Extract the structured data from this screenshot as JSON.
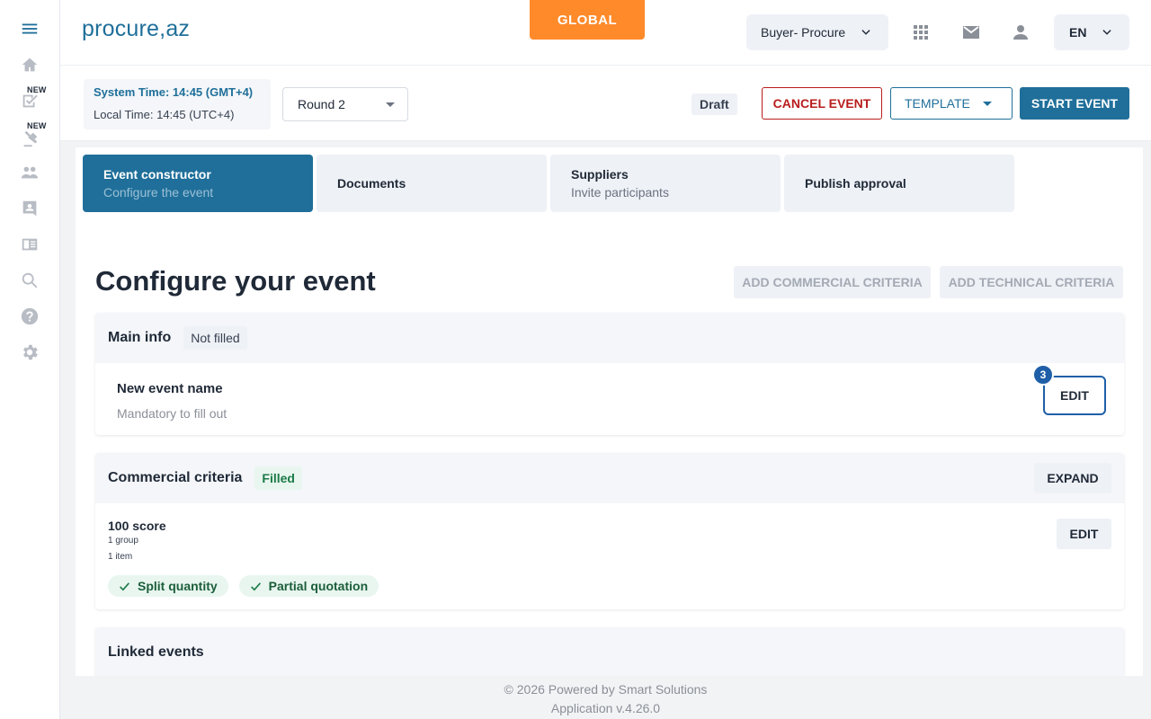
{
  "app": {
    "logo": {
      "part1": "procure",
      "comma": ",",
      "part2": "az"
    },
    "global_label": "GLOBAL",
    "buyer_select": "Buyer- Procure",
    "language": "EN"
  },
  "sidebar": {
    "new_badge_1": "NEW",
    "new_badge_2": "NEW"
  },
  "toolbar": {
    "system_time": "System Time: 14:45 (GMT+4)",
    "local_time": "Local Time: 14:45 (UTC+4)",
    "round": "Round 2",
    "status": "Draft",
    "cancel_label": "CANCEL EVENT",
    "template_label": "TEMPLATE",
    "start_label": "START EVENT"
  },
  "steps": [
    {
      "title": "Event constructor",
      "subtitle": "Configure the event"
    },
    {
      "title": "Documents",
      "subtitle": ""
    },
    {
      "title": "Suppliers",
      "subtitle": "Invite participants"
    },
    {
      "title": "Publish approval",
      "subtitle": ""
    }
  ],
  "main": {
    "title": "Configure your event",
    "add_commercial": "ADD COMMERCIAL CRITERIA",
    "add_technical": "ADD TECHNICAL CRITERIA",
    "main_info": {
      "title": "Main info",
      "status": "Not filled",
      "event_name": "New event name",
      "hint": "Mandatory to fill out",
      "edit_label": "EDIT",
      "step_number": "3"
    },
    "commercial": {
      "title": "Commercial criteria",
      "status": "Filled",
      "expand_label": "EXPAND",
      "score": "100 score",
      "groups": "1 group",
      "items": "1 item",
      "edit_label": "EDIT",
      "chips": [
        "Split quantity",
        "Partial quotation"
      ]
    },
    "linked": {
      "title": "Linked events"
    }
  },
  "footer": {
    "copyright": "© 2026 Powered by Smart Solutions",
    "version": "Application v.4.26.0"
  },
  "colors": {
    "primary": "#1f6f9a",
    "accent_orange": "#ff8a2a",
    "danger": "#b91c1c",
    "success_bg": "#e8f6ef",
    "success_text": "#1b7a47"
  },
  "icons": {
    "sidebar": [
      "menu-icon",
      "home-icon",
      "task-check-icon",
      "auction-gavel-icon",
      "people-icon",
      "contact-card-icon",
      "catalog-icon",
      "search-icon",
      "help-icon",
      "settings-gear-icon"
    ],
    "header": [
      "chevron-down-icon",
      "apps-grid-icon",
      "mail-icon",
      "user-icon"
    ]
  }
}
